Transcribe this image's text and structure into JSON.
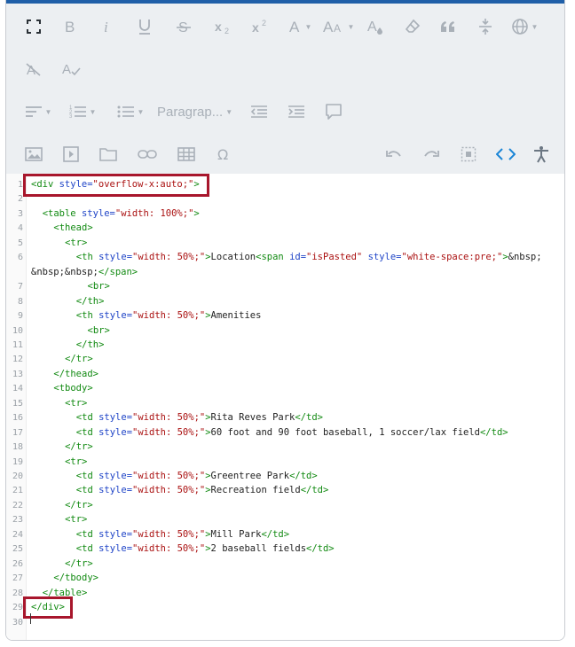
{
  "toolbar": {
    "paragraph_label": "Paragrap...",
    "colors": {
      "icon": "#6b7682",
      "icon_dim": "#a9b0b8",
      "active": "#1a85d6",
      "topbar": "#1f5fa8"
    }
  },
  "code_lines": [
    {
      "n": "1",
      "indent": 0,
      "parts": [
        [
          "tag",
          "<div "
        ],
        [
          "attr",
          "style="
        ],
        [
          "str",
          "\"overflow-x:auto;\""
        ],
        [
          "tag",
          ">"
        ]
      ]
    },
    {
      "n": "2",
      "indent": 0,
      "parts": []
    },
    {
      "n": "3",
      "indent": 2,
      "parts": [
        [
          "tag",
          "<table "
        ],
        [
          "attr",
          "style="
        ],
        [
          "str",
          "\"width: 100%;\""
        ],
        [
          "tag",
          ">"
        ]
      ]
    },
    {
      "n": "4",
      "indent": 4,
      "parts": [
        [
          "tag",
          "<thead>"
        ]
      ]
    },
    {
      "n": "5",
      "indent": 6,
      "parts": [
        [
          "tag",
          "<tr>"
        ]
      ]
    },
    {
      "n": "6",
      "indent": 8,
      "parts": [
        [
          "tag",
          "<th "
        ],
        [
          "attr",
          "style="
        ],
        [
          "str",
          "\"width: 50%;\""
        ],
        [
          "tag",
          ">"
        ],
        [
          "text",
          "Location"
        ],
        [
          "tag",
          "<span "
        ],
        [
          "attr",
          "id="
        ],
        [
          "str",
          "\"isPasted\" "
        ],
        [
          "attr",
          "style="
        ],
        [
          "str",
          "\"white-space:pre;\""
        ],
        [
          "tag",
          ">"
        ],
        [
          "text",
          "&nbsp;"
        ]
      ]
    },
    {
      "n": "",
      "indent": 0,
      "parts": [
        [
          "text",
          "&nbsp;&nbsp;"
        ],
        [
          "tag",
          "</span>"
        ]
      ]
    },
    {
      "n": "7",
      "indent": 10,
      "parts": [
        [
          "tag",
          "<br>"
        ]
      ]
    },
    {
      "n": "8",
      "indent": 8,
      "parts": [
        [
          "tag",
          "</th>"
        ]
      ]
    },
    {
      "n": "9",
      "indent": 8,
      "parts": [
        [
          "tag",
          "<th "
        ],
        [
          "attr",
          "style="
        ],
        [
          "str",
          "\"width: 50%;\""
        ],
        [
          "tag",
          ">"
        ],
        [
          "text",
          "Amenities"
        ]
      ]
    },
    {
      "n": "10",
      "indent": 10,
      "parts": [
        [
          "tag",
          "<br>"
        ]
      ]
    },
    {
      "n": "11",
      "indent": 8,
      "parts": [
        [
          "tag",
          "</th>"
        ]
      ]
    },
    {
      "n": "12",
      "indent": 6,
      "parts": [
        [
          "tag",
          "</tr>"
        ]
      ]
    },
    {
      "n": "13",
      "indent": 4,
      "parts": [
        [
          "tag",
          "</thead>"
        ]
      ]
    },
    {
      "n": "14",
      "indent": 4,
      "parts": [
        [
          "tag",
          "<tbody>"
        ]
      ]
    },
    {
      "n": "15",
      "indent": 6,
      "parts": [
        [
          "tag",
          "<tr>"
        ]
      ]
    },
    {
      "n": "16",
      "indent": 8,
      "parts": [
        [
          "tag",
          "<td "
        ],
        [
          "attr",
          "style="
        ],
        [
          "str",
          "\"width: 50%;\""
        ],
        [
          "tag",
          ">"
        ],
        [
          "text",
          "Rita Reves Park"
        ],
        [
          "tag",
          "</td>"
        ]
      ]
    },
    {
      "n": "17",
      "indent": 8,
      "parts": [
        [
          "tag",
          "<td "
        ],
        [
          "attr",
          "style="
        ],
        [
          "str",
          "\"width: 50%;\""
        ],
        [
          "tag",
          ">"
        ],
        [
          "text",
          "60 foot and 90 foot baseball, 1 soccer/lax field"
        ],
        [
          "tag",
          "</td>"
        ]
      ]
    },
    {
      "n": "18",
      "indent": 6,
      "parts": [
        [
          "tag",
          "</tr>"
        ]
      ]
    },
    {
      "n": "19",
      "indent": 6,
      "parts": [
        [
          "tag",
          "<tr>"
        ]
      ]
    },
    {
      "n": "20",
      "indent": 8,
      "parts": [
        [
          "tag",
          "<td "
        ],
        [
          "attr",
          "style="
        ],
        [
          "str",
          "\"width: 50%;\""
        ],
        [
          "tag",
          ">"
        ],
        [
          "text",
          "Greentree Park"
        ],
        [
          "tag",
          "</td>"
        ]
      ]
    },
    {
      "n": "21",
      "indent": 8,
      "parts": [
        [
          "tag",
          "<td "
        ],
        [
          "attr",
          "style="
        ],
        [
          "str",
          "\"width: 50%;\""
        ],
        [
          "tag",
          ">"
        ],
        [
          "text",
          "Recreation field"
        ],
        [
          "tag",
          "</td>"
        ]
      ]
    },
    {
      "n": "22",
      "indent": 6,
      "parts": [
        [
          "tag",
          "</tr>"
        ]
      ]
    },
    {
      "n": "23",
      "indent": 6,
      "parts": [
        [
          "tag",
          "<tr>"
        ]
      ]
    },
    {
      "n": "24",
      "indent": 8,
      "parts": [
        [
          "tag",
          "<td "
        ],
        [
          "attr",
          "style="
        ],
        [
          "str",
          "\"width: 50%;\""
        ],
        [
          "tag",
          ">"
        ],
        [
          "text",
          "Mill Park"
        ],
        [
          "tag",
          "</td>"
        ]
      ]
    },
    {
      "n": "25",
      "indent": 8,
      "parts": [
        [
          "tag",
          "<td "
        ],
        [
          "attr",
          "style="
        ],
        [
          "str",
          "\"width: 50%;\""
        ],
        [
          "tag",
          ">"
        ],
        [
          "text",
          "2 baseball fields"
        ],
        [
          "tag",
          "</td>"
        ]
      ]
    },
    {
      "n": "26",
      "indent": 6,
      "parts": [
        [
          "tag",
          "</tr>"
        ]
      ]
    },
    {
      "n": "27",
      "indent": 4,
      "parts": [
        [
          "tag",
          "</tbody>"
        ]
      ]
    },
    {
      "n": "28",
      "indent": 2,
      "parts": [
        [
          "tag",
          "</table>"
        ]
      ]
    },
    {
      "n": "29",
      "indent": 0,
      "parts": [
        [
          "tag",
          "</div>"
        ]
      ]
    },
    {
      "n": "30",
      "indent": 0,
      "parts": []
    }
  ]
}
